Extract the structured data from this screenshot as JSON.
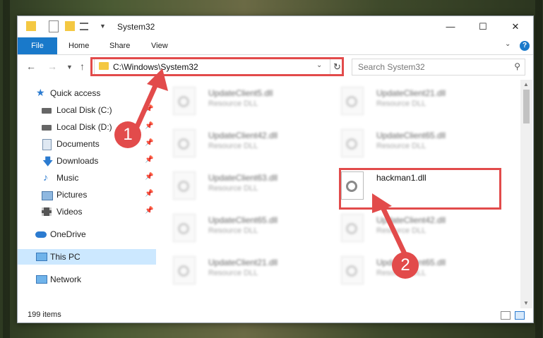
{
  "window": {
    "title": "System32",
    "minimize_glyph": "—",
    "maximize_glyph": "☐",
    "close_glyph": "✕"
  },
  "ribbon": {
    "tabs": [
      "File",
      "Home",
      "Share",
      "View"
    ],
    "help_glyph": "?"
  },
  "navigation": {
    "address": "C:\\Windows\\System32",
    "search_placeholder": "Search System32"
  },
  "sidebar": {
    "items": [
      {
        "label": "Quick access",
        "icon": "star-icon"
      },
      {
        "label": "Local Disk (C:)",
        "icon": "drive-icon",
        "pinned": true
      },
      {
        "label": "Local Disk (D:)",
        "icon": "drive-icon",
        "pinned": true
      },
      {
        "label": "Documents",
        "icon": "documents-icon",
        "pinned": true
      },
      {
        "label": "Downloads",
        "icon": "download-arrow-icon",
        "pinned": true
      },
      {
        "label": "Music",
        "icon": "music-note-icon",
        "pinned": true
      },
      {
        "label": "Pictures",
        "icon": "pictures-icon",
        "pinned": true
      },
      {
        "label": "Videos",
        "icon": "film-icon",
        "pinned": true
      },
      {
        "label": "OneDrive",
        "icon": "cloud-icon"
      },
      {
        "label": "This PC",
        "icon": "monitor-icon",
        "selected": true
      },
      {
        "label": "Network",
        "icon": "network-icon"
      }
    ]
  },
  "files": {
    "blurred_type": "Resource DLL",
    "left_column": [
      "UpdateClient5.dll",
      "UpdateClient42.dll",
      "UpdateClient63.dll",
      "UpdateClient65.dll",
      "UpdateClient21.dll"
    ],
    "right_column": [
      "UpdateClient21.dll",
      "UpdateClient65.dll",
      "",
      "UpdateClient42.dll",
      "UpdateClient65.dll"
    ],
    "highlighted": "hackman1.dll"
  },
  "status": {
    "item_count": "199 items"
  },
  "annotations": {
    "step1": "1",
    "step2": "2"
  },
  "colors": {
    "accent": "#1979ca",
    "highlight": "#e24b4b",
    "selected": "#cce8ff"
  }
}
